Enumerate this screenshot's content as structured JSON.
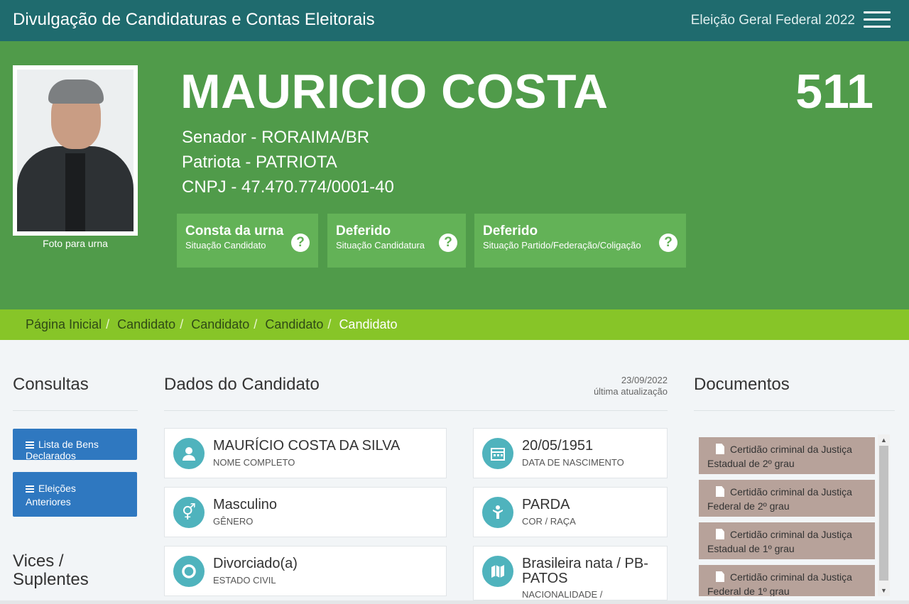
{
  "header": {
    "title": "Divulgação de Candidaturas e Contas Eleitorais",
    "election": "Eleição Geral Federal 2022",
    "menu_icon": "hamburger-menu-icon"
  },
  "candidate": {
    "name": "MAURICIO COSTA",
    "number": "511",
    "office": "Senador - RORAIMA/BR",
    "party": "Patriota - PATRIOTA",
    "cnpj": "CNPJ - 47.470.774/0001-40",
    "photo_caption": "Foto para urna"
  },
  "status": [
    {
      "title": "Consta da urna",
      "subtitle": "Situação Candidato"
    },
    {
      "title": "Deferido",
      "subtitle": "Situação Candidatura"
    },
    {
      "title": "Deferido",
      "subtitle": "Situação Partido/Federação/Coligação"
    }
  ],
  "breadcrumb": {
    "items": [
      "Página Inicial",
      "Candidato",
      "Candidato",
      "Candidato"
    ],
    "current": "Candidato"
  },
  "sidebar": {
    "title": "Consultas",
    "buttons": [
      {
        "label": "Lista de Bens Declarados"
      },
      {
        "label_line1": "Eleições",
        "label_line2": "Anteriores"
      }
    ],
    "vices_title_line1": "Vices /",
    "vices_title_line2": "Suplentes"
  },
  "main": {
    "title": "Dados do Candidato",
    "update_date": "23/09/2022",
    "update_label": "última atualização",
    "fields": [
      {
        "value": "MAURÍCIO COSTA DA SILVA",
        "label": "NOME COMPLETO",
        "icon": "user-icon"
      },
      {
        "value": "20/05/1951",
        "label": "DATA DE NASCIMENTO",
        "icon": "calendar-icon"
      },
      {
        "value": "Masculino",
        "label": "GÊNERO",
        "icon": "gender-icon"
      },
      {
        "value": "PARDA",
        "label": "COR / RAÇA",
        "icon": "person-icon"
      },
      {
        "value": "Divorciado(a)",
        "label": "ESTADO CIVIL",
        "icon": "ring-icon"
      },
      {
        "value_line1": "Brasileira nata / PB-",
        "value_line2": "PATOS",
        "label": "NACIONALIDADE /",
        "icon": "map-icon"
      }
    ]
  },
  "documents": {
    "title": "Documentos",
    "items": [
      {
        "line1": "Certidão criminal da Justiça",
        "line2": "Estadual de 2º grau"
      },
      {
        "line1": "Certidão criminal da Justiça",
        "line2": "Federal de 2º grau"
      },
      {
        "line1": "Certidão criminal da Justiça",
        "line2": "Estadual de 1º grau"
      },
      {
        "line1": "Certidão criminal da Justiça",
        "line2": "Federal de 1º grau"
      }
    ]
  },
  "colors": {
    "topbar": "#1f6b6e",
    "hero": "#509b4a",
    "status_box": "#63b257",
    "breadcrumb": "#87c528",
    "button": "#2f78c0",
    "icon_circle": "#4fb3bd",
    "document": "#b7a29a"
  }
}
